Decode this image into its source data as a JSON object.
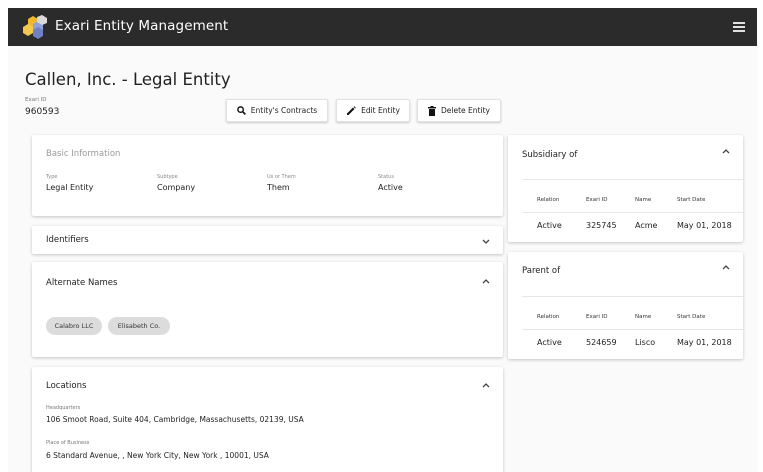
{
  "app": {
    "title": "Exari Entity Management"
  },
  "entity": {
    "title": "Callen, Inc. - Legal Entity",
    "exari_id_label": "Exari ID",
    "exari_id": "960593"
  },
  "actions": {
    "contracts": "Entity's Contracts",
    "edit": "Edit Entity",
    "delete": "Delete Entity"
  },
  "basic_info": {
    "title": "Basic Information",
    "fields": [
      {
        "label": "Type",
        "value": "Legal Entity"
      },
      {
        "label": "Subtype",
        "value": "Company"
      },
      {
        "label": "Us or Them",
        "value": "Them"
      },
      {
        "label": "Status",
        "value": "Active"
      }
    ]
  },
  "identifiers": {
    "title": "Identifiers"
  },
  "alternate_names": {
    "title": "Alternate Names",
    "chips": [
      "Calabro LLC",
      "Elisabeth Co."
    ]
  },
  "locations": {
    "title": "Locations",
    "items": [
      {
        "label": "Headquarters",
        "value": "106 Smoot Road, Suite 404, Cambridge, Massachusetts, 02139, USA"
      },
      {
        "label": "Place of Business",
        "value": "6 Standard Avenue, , New York City, New York , 10001, USA"
      }
    ]
  },
  "subsidiary_of": {
    "title": "Subsidiary of",
    "columns": [
      "Relation",
      "Exari ID",
      "Name",
      "Start Date"
    ],
    "rows": [
      [
        "Active",
        "325745",
        "Acme",
        "May 01, 2018"
      ]
    ]
  },
  "parent_of": {
    "title": "Parent of",
    "columns": [
      "Relation",
      "Exari ID",
      "Name",
      "Start Date"
    ],
    "rows": [
      [
        "Active",
        "524659",
        "Lisco",
        "May 01, 2018"
      ]
    ]
  },
  "colors": {
    "appbar": "#2b2b2b",
    "chip": "#dcdcdc",
    "logo_yellow": "#f2b92e",
    "logo_blue": "#7f8fd0"
  }
}
